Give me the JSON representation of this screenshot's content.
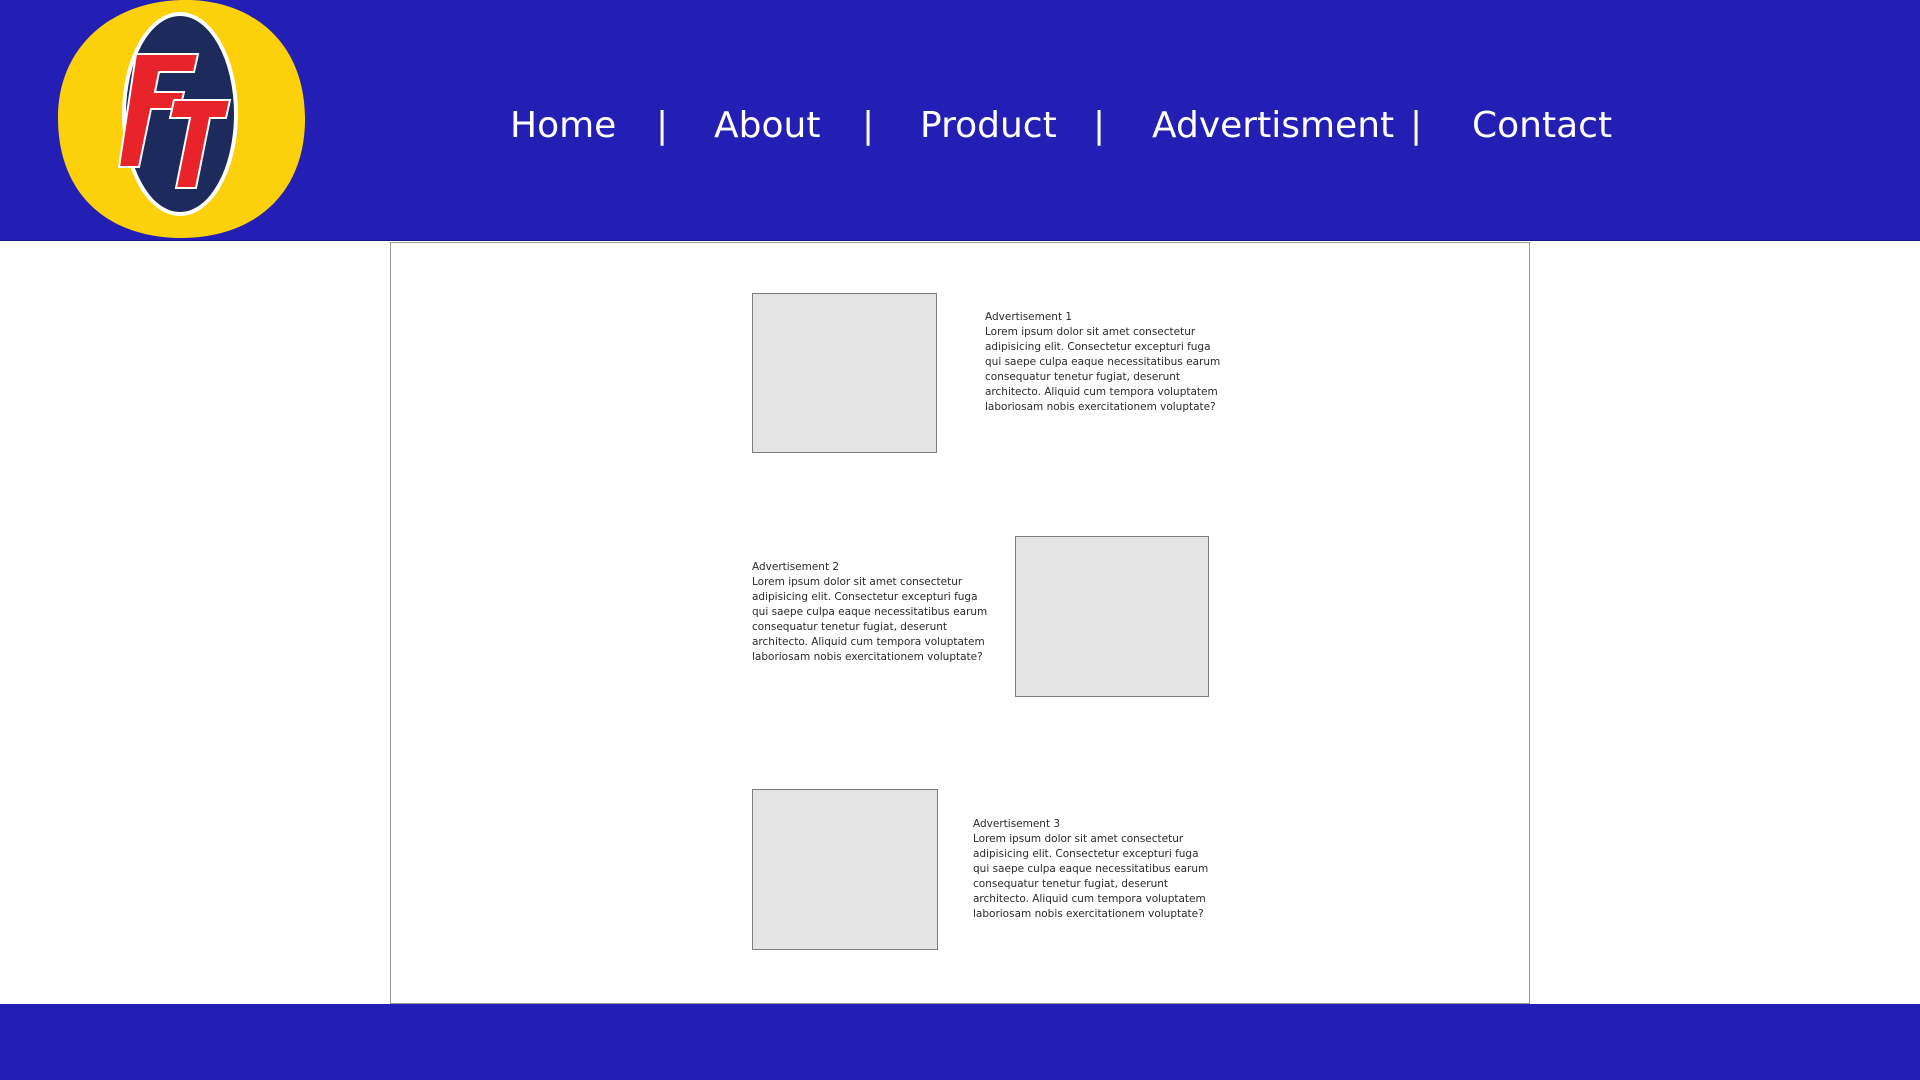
{
  "brand": {
    "logo_text": "FT",
    "colors": {
      "header_bg": "#231eb4",
      "logo_circle": "#fcd00a",
      "logo_oval": "#1c2a5c",
      "logo_letters": "#e8232a"
    }
  },
  "nav": {
    "items": [
      {
        "label": "Home"
      },
      {
        "label": "About"
      },
      {
        "label": "Product"
      },
      {
        "label": "Advertisment"
      },
      {
        "label": "Contact"
      }
    ],
    "separator": "|"
  },
  "ads": [
    {
      "title": "Advertisement 1",
      "body": "Lorem ipsum dolor sit amet consectetur adipisicing elit. Consectetur excepturi fuga qui saepe culpa eaque necessitatibus earum consequatur tenetur fugiat, deserunt architecto. Aliquid cum tempora voluptatem laboriosam nobis exercitationem voluptate?"
    },
    {
      "title": "Advertisement 2",
      "body": "Lorem ipsum dolor sit amet consectetur adipisicing elit. Consectetur excepturi fuga qui saepe culpa eaque necessitatibus earum consequatur tenetur fugiat, deserunt architecto. Aliquid cum tempora voluptatem laboriosam nobis exercitationem voluptate?"
    },
    {
      "title": "Advertisement 3",
      "body": "Lorem ipsum dolor sit amet consectetur adipisicing elit. Consectetur excepturi fuga qui saepe culpa eaque necessitatibus earum consequatur tenetur fugiat, deserunt architecto. Aliquid cum tempora voluptatem laboriosam nobis exercitationem voluptate?"
    }
  ]
}
